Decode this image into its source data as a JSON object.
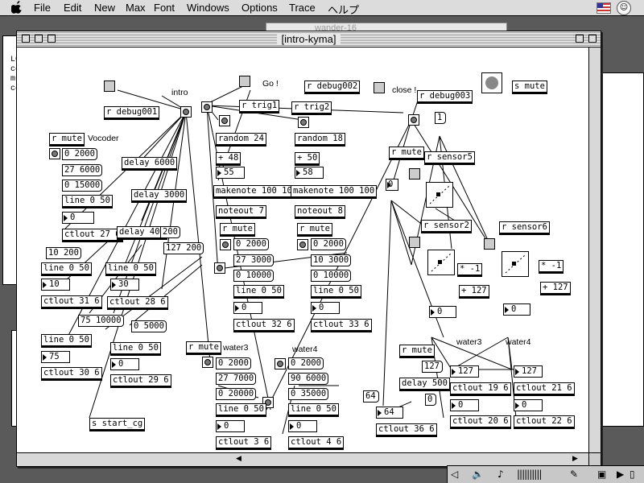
{
  "menubar": {
    "apple": "",
    "items": [
      "File",
      "Edit",
      "New",
      "Max",
      "Font",
      "Windows",
      "Options",
      "Trace",
      "ヘルプ"
    ]
  },
  "background": {
    "wander_title": "wander-16",
    "lc_lines": [
      "LC",
      "co",
      "mu",
      "co"
    ]
  },
  "window": {
    "title": "[intro-kyma]"
  },
  "patch": {
    "objects": [
      {
        "id": "o1",
        "text": "r debug001"
      },
      {
        "id": "o2",
        "text": "r debug002"
      },
      {
        "id": "o3",
        "text": "r debug003"
      },
      {
        "id": "o4",
        "text": "s mute"
      },
      {
        "id": "o5",
        "text": "r trig1"
      },
      {
        "id": "o6",
        "text": "r trig2"
      },
      {
        "id": "o7",
        "text": "r mute"
      },
      {
        "id": "o8",
        "text": "delay 6000"
      },
      {
        "id": "o9",
        "text": "delay 3000"
      },
      {
        "id": "o10",
        "text": "delay 400"
      },
      {
        "id": "o11",
        "text": "line 0 50"
      },
      {
        "id": "o12",
        "text": "ctlout 27 6"
      },
      {
        "id": "o13",
        "text": "random 24"
      },
      {
        "id": "o14",
        "text": "random 18"
      },
      {
        "id": "o15",
        "text": "+ 48"
      },
      {
        "id": "o16",
        "text": "+ 50"
      },
      {
        "id": "o17",
        "text": "makenote 100 100"
      },
      {
        "id": "o18",
        "text": "makenote 100 100"
      },
      {
        "id": "o19",
        "text": "noteout 7"
      },
      {
        "id": "o20",
        "text": "noteout 8"
      },
      {
        "id": "o21",
        "text": "r mute"
      },
      {
        "id": "o22",
        "text": "r mute"
      },
      {
        "id": "o23",
        "text": "line 0 50"
      },
      {
        "id": "o24",
        "text": "line 0 50"
      },
      {
        "id": "o25",
        "text": "ctlout 32 6"
      },
      {
        "id": "o26",
        "text": "ctlout 33 6"
      },
      {
        "id": "o27",
        "text": "line 0 50"
      },
      {
        "id": "o28",
        "text": "ctlout 28 6"
      },
      {
        "id": "o29",
        "text": "line 0 50"
      },
      {
        "id": "o30",
        "text": "ctlout 31 6"
      },
      {
        "id": "o31",
        "text": "line 0 50"
      },
      {
        "id": "o32",
        "text": "ctlout 30 6"
      },
      {
        "id": "o33",
        "text": "line 0 50"
      },
      {
        "id": "o34",
        "text": "ctlout 29 6"
      },
      {
        "id": "o35",
        "text": "s start_cg"
      },
      {
        "id": "o36",
        "text": "r mute"
      },
      {
        "id": "o37",
        "text": "line 0 50"
      },
      {
        "id": "o38",
        "text": "line 0 50"
      },
      {
        "id": "o39",
        "text": "ctlout 3 6"
      },
      {
        "id": "o40",
        "text": "ctlout 4 6"
      },
      {
        "id": "o41",
        "text": "r mute"
      },
      {
        "id": "o42",
        "text": "r sensor5"
      },
      {
        "id": "o43",
        "text": "r sensor2"
      },
      {
        "id": "o44",
        "text": "r sensor6"
      },
      {
        "id": "o45",
        "text": "* -1"
      },
      {
        "id": "o46",
        "text": "* -1"
      },
      {
        "id": "o47",
        "text": "+ 127"
      },
      {
        "id": "o48",
        "text": "+ 127"
      },
      {
        "id": "o49",
        "text": "r mute"
      },
      {
        "id": "o50",
        "text": "delay 500"
      },
      {
        "id": "o51",
        "text": "ctlout 19 6"
      },
      {
        "id": "o52",
        "text": "ctlout 21 6"
      },
      {
        "id": "o53",
        "text": "ctlout 20 6"
      },
      {
        "id": "o54",
        "text": "ctlout 22 6"
      },
      {
        "id": "o55",
        "text": "ctlout 36 6"
      }
    ],
    "messages": [
      {
        "id": "m1",
        "text": "0 2000"
      },
      {
        "id": "m2",
        "text": "27 6000"
      },
      {
        "id": "m3",
        "text": "0 15000"
      },
      {
        "id": "m4",
        "text": "200"
      },
      {
        "id": "m5",
        "text": "127 200"
      },
      {
        "id": "m6",
        "text": "10 200"
      },
      {
        "id": "m7",
        "text": "75 10000"
      },
      {
        "id": "m8",
        "text": "0 5000"
      },
      {
        "id": "m9",
        "text": "0 2000"
      },
      {
        "id": "m10",
        "text": "27 3000"
      },
      {
        "id": "m11",
        "text": "0 10000"
      },
      {
        "id": "m12",
        "text": "0 2000"
      },
      {
        "id": "m13",
        "text": "10 3000"
      },
      {
        "id": "m14",
        "text": "0 10000"
      },
      {
        "id": "m15",
        "text": "0 2000"
      },
      {
        "id": "m16",
        "text": "27 7000"
      },
      {
        "id": "m17",
        "text": "0 20000"
      },
      {
        "id": "m18",
        "text": "0 2000"
      },
      {
        "id": "m19",
        "text": "90 6000"
      },
      {
        "id": "m20",
        "text": "0 35000"
      },
      {
        "id": "m21",
        "text": "1"
      },
      {
        "id": "m22",
        "text": "64"
      },
      {
        "id": "m23",
        "text": "127"
      },
      {
        "id": "m24",
        "text": "0"
      }
    ],
    "numbers": [
      {
        "id": "n1",
        "text": "0"
      },
      {
        "id": "n2",
        "text": "55"
      },
      {
        "id": "n3",
        "text": "58"
      },
      {
        "id": "n4",
        "text": "0"
      },
      {
        "id": "n5",
        "text": "0"
      },
      {
        "id": "n6",
        "text": "30"
      },
      {
        "id": "n7",
        "text": "10"
      },
      {
        "id": "n8",
        "text": "75"
      },
      {
        "id": "n9",
        "text": "0"
      },
      {
        "id": "n10",
        "text": "0"
      },
      {
        "id": "n11",
        "text": "0"
      },
      {
        "id": "n12",
        "text": "0"
      },
      {
        "id": "n13",
        "text": "0"
      },
      {
        "id": "n14",
        "text": "0"
      },
      {
        "id": "n15",
        "text": "127"
      },
      {
        "id": "n16",
        "text": "127"
      },
      {
        "id": "n17",
        "text": "0"
      },
      {
        "id": "n18",
        "text": "0"
      },
      {
        "id": "n19",
        "text": "64"
      }
    ],
    "labels": [
      {
        "id": "l1",
        "text": "intro"
      },
      {
        "id": "l2",
        "text": "Go !"
      },
      {
        "id": "l3",
        "text": "close !"
      },
      {
        "id": "l4",
        "text": "Vocoder"
      },
      {
        "id": "l5",
        "text": "water3"
      },
      {
        "id": "l6",
        "text": "water4"
      },
      {
        "id": "l7",
        "text": "water3"
      },
      {
        "id": "l8",
        "text": "water4"
      }
    ]
  },
  "taskbar": {
    "icons": [
      "speaker-icon",
      "control-strip-icon"
    ]
  }
}
